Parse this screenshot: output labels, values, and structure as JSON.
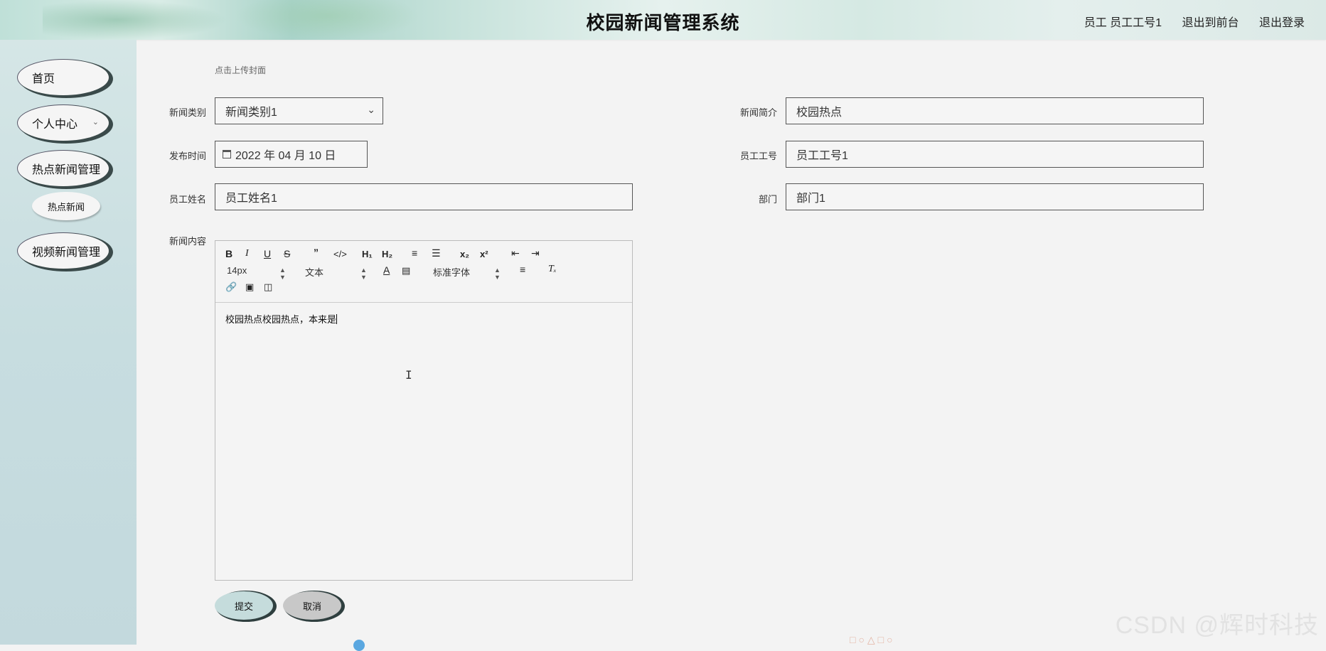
{
  "header": {
    "title": "校园新闻管理系统",
    "user": "员工 员工工号1",
    "to_front": "退出到前台",
    "logout": "退出登录"
  },
  "sidebar": {
    "items": [
      {
        "label": "首页"
      },
      {
        "label": "个人中心"
      },
      {
        "label": "热点新闻管理"
      },
      {
        "label": "热点新闻"
      },
      {
        "label": "视频新闻管理"
      }
    ]
  },
  "form": {
    "upload_hint": "点击上传封面",
    "category_label": "新闻类别",
    "category_value": "新闻类别1",
    "summary_label": "新闻简介",
    "summary_value": "校园热点",
    "publish_time_label": "发布时间",
    "publish_time_value": "2022 年 04 月 10 日",
    "emp_no_label": "员工工号",
    "emp_no_value": "员工工号1",
    "emp_name_label": "员工姓名",
    "emp_name_value": "员工姓名1",
    "dept_label": "部门",
    "dept_value": "部门1",
    "content_label": "新闻内容",
    "content_value": "校园热点校园热点，本来是",
    "submit": "提交",
    "cancel": "取消"
  },
  "editor": {
    "size_select": "14px",
    "block_select": "文本",
    "font_select": "标准字体"
  },
  "watermark": "CSDN @辉时科技"
}
